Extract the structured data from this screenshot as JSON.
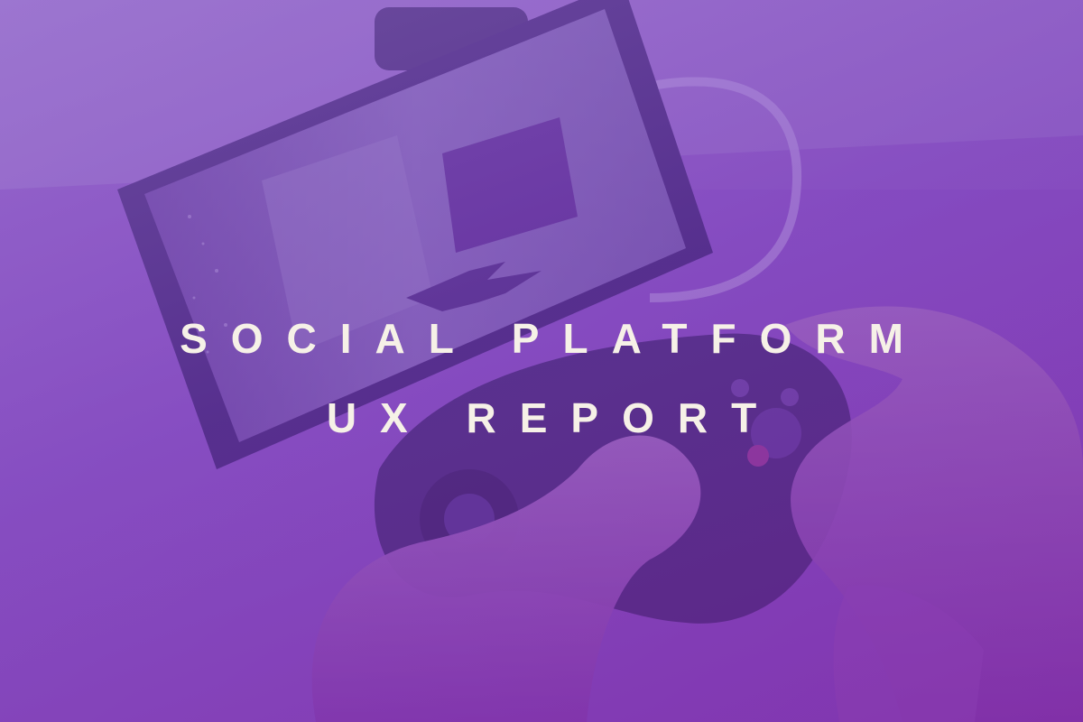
{
  "hero": {
    "title_line_1": "SOCIAL PLATFORM",
    "title_line_2": "UX REPORT"
  },
  "colors": {
    "overlay_purple": "#7b3fb8",
    "title_text": "#f6f1e7"
  },
  "image": {
    "subject_icons": [
      "smartphone-icon",
      "game-controller-icon",
      "hands-icon"
    ]
  }
}
